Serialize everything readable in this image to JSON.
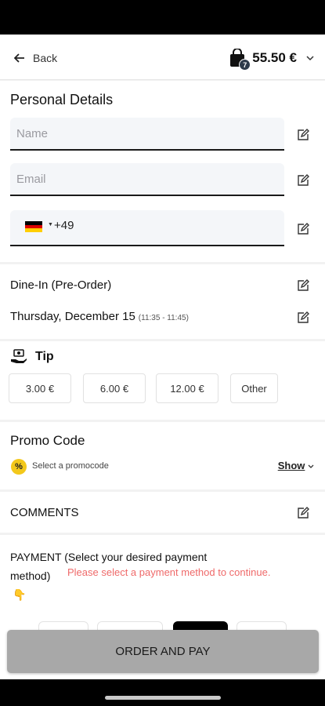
{
  "header": {
    "back_label": "Back",
    "cart_count": "7",
    "cart_total": "55.50 €"
  },
  "personal": {
    "title": "Personal Details",
    "name_placeholder": "Name",
    "email_placeholder": "Email",
    "dial_code": "+49"
  },
  "order": {
    "type": "Dine-In (Pre-Order)",
    "date": "Thursday, December 15",
    "time_range": "(11:35 - 11:45)"
  },
  "tip": {
    "title": "Tip",
    "options": [
      "3.00 €",
      "6.00 €",
      "12.00 €",
      "Other"
    ]
  },
  "promo": {
    "title": "Promo Code",
    "select_label": "Select a promocode",
    "show_label": "Show"
  },
  "comments": {
    "title": "COMMENTS"
  },
  "payment": {
    "title": "PAYMENT (Select your desired payment method)",
    "warning": "Please select a payment method to continue."
  },
  "footer": {
    "order_button": "ORDER AND PAY"
  },
  "colors": {
    "warning": "#ef6a6a",
    "order_button_disabled": "#a8a8a8",
    "promo_badge": "#f3c81b"
  }
}
